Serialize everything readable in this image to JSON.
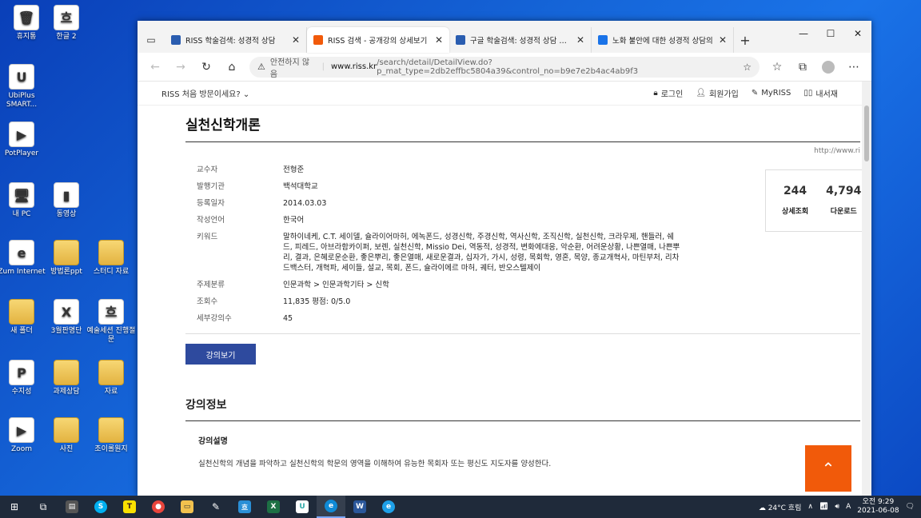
{
  "desktop_icons": [
    {
      "label": "휴지통",
      "glyph": "🗑"
    },
    {
      "label": "한글 2",
      "glyph": "흐"
    },
    {
      "label": "UbiPlus SMART...",
      "glyph": "U"
    },
    {
      "label": "PotPlayer",
      "glyph": "▶"
    },
    {
      "label": "내 PC",
      "glyph": "🖥"
    },
    {
      "label": "동영상",
      "glyph": "▮"
    },
    {
      "label": "Zum Internet",
      "glyph": "e"
    },
    {
      "label": "방법론ppt",
      "glyph": ""
    },
    {
      "label": "스터디 자료",
      "glyph": ""
    },
    {
      "label": "새 폴더",
      "glyph": ""
    },
    {
      "label": "3월판명단",
      "glyph": "X"
    },
    {
      "label": "예술세션 진행절문",
      "glyph": "흐"
    },
    {
      "label": "수지성",
      "glyph": "P"
    },
    {
      "label": "과제상담",
      "glyph": ""
    },
    {
      "label": "자료",
      "glyph": ""
    },
    {
      "label": "Zoom",
      "glyph": "▶"
    },
    {
      "label": "사진",
      "glyph": ""
    },
    {
      "label": "조이롤원지",
      "glyph": ""
    }
  ],
  "browser": {
    "tabs": [
      {
        "title": "RISS 학술검색: 성경적 상담",
        "active": false,
        "fav_color": "#2a5db0"
      },
      {
        "title": "RISS 검색 - 공개강의 상세보기",
        "active": true,
        "fav_color": "#f15a0a"
      },
      {
        "title": "구글 학술검색: 성경적 상담 검색",
        "active": false,
        "fav_color": "#2a5db0"
      },
      {
        "title": "노화 불안에 대한 성경적 상담의",
        "active": false,
        "fav_color": "#1a73e8"
      }
    ],
    "address": {
      "insecure": "안전하지 않음",
      "host": "www.riss.kr",
      "path": "/search/detail/DetailView.do?p_mat_type=2db2effbc5804a39&control_no=b9e7e2b4ac4ab9f3"
    }
  },
  "site": {
    "visit": "RISS 처음 방문이세요?",
    "links": [
      "로그인",
      "회원가입",
      "MyRISS",
      "내서재"
    ]
  },
  "detail": {
    "title": "실천신학개론",
    "url_note": "http://www.ri",
    "fields": [
      {
        "k": "교수자",
        "v": "전형준"
      },
      {
        "k": "발행기관",
        "v": "백석대학교"
      },
      {
        "k": "등록일자",
        "v": "2014.03.03"
      },
      {
        "k": "작성언어",
        "v": "한국어"
      },
      {
        "k": "키워드",
        "v": "말하이네케, C.T. 세이델, 슐라이어마허, 에녹폰드, 성경신학, 주경신학, 역사신학, 조직신학, 실천신학, 크라우제, 핸들러, 쉐드, 피레드, 아브라함카이퍼, 보렌, 실천신학, Missio Dei, 역동적, 성경적, 변화에대응, 악순환, 어려운상황, 나쁜열매, 나쁜뿌리, 결과, 은혜로운순환, 좋은뿌리, 좋은열매, 새로운결과, 십자가, 가시, 성령, 목회학, 영혼, 목양, 종교개혁사, 마틴부처, 리차드백스터, 개혁파, 세이들, 설교, 목회, 폰드, 슐라이에르 마허, 궤터, 반오스텔제이"
      },
      {
        "k": "주제분류",
        "v": "인문과학  > 인문과학기타  > 신학"
      },
      {
        "k": "조회수",
        "v": "11,835  평점: 0/5.0"
      },
      {
        "k": "세부강의수",
        "v": "45"
      }
    ],
    "stats": [
      {
        "n": "244",
        "l": "상세조회"
      },
      {
        "n": "4,794",
        "l": "다운로드"
      }
    ],
    "lecture_button": "강의보기",
    "section_title": "강의정보",
    "sub_heading": "강의설명",
    "description": "실천신학의 개념을 파악하고 실천신학의 학문의 영역을 이해하여 유능한 목회자 또는 평신도 지도자를 양성한다.",
    "to_top": "^"
  },
  "taskbar": {
    "weather": "24°C 흐림",
    "time": "오전 9:29",
    "date": "2021-06-08"
  }
}
